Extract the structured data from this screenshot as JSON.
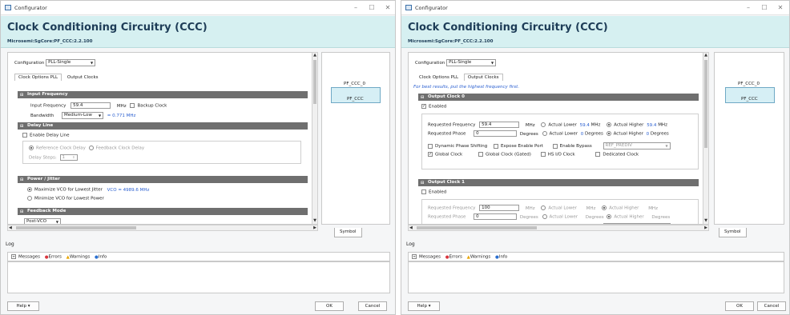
{
  "windows": [
    {
      "title": "Configurator",
      "header_title": "Clock Conditioning Circuitry (CCC)",
      "header_sub": "Microsemi:SgCore:PF_CCC:2.2.100",
      "config_label": "Configuration",
      "config_value": "PLL-Single",
      "tabs": [
        "Clock Options PLL",
        "Output Clocks"
      ],
      "sections": {
        "input": "Input Frequency",
        "delay": "Delay Line",
        "power": "Power / Jitter",
        "feedback": "Feedback Mode"
      },
      "input_freq_label": "Input Frequency",
      "input_freq_value": "59.4",
      "mhz": "MHz",
      "backup_clock": "Backup Clock",
      "bandwidth_label": "Bandwidth",
      "bandwidth_value": "Medium-Low",
      "bandwidth_result": "= 0.771 MHz",
      "enable_delay": "Enable Delay Line",
      "ref_clock_delay": "Reference Clock Delay",
      "fb_clock_delay": "Feedback Clock Delay",
      "delay_steps_label": "Delay Steps:",
      "delay_steps_value": "1",
      "max_vco": "Maximize VCO for Lowest Jitter",
      "vco_value": "VCO = 4989.6 MHz",
      "min_vco": "Minimize VCO for Lowest Power",
      "feedback_value": "Post-VCO",
      "symbol_name": "PF_CCC_0",
      "symbol_sub": "PF_CCC",
      "symbol_tab": "Symbol",
      "log_label": "Log",
      "log_filters": [
        "Messages",
        "Errors",
        "Warnings",
        "Info"
      ],
      "help": "Help",
      "ok": "OK",
      "cancel": "Cancel"
    },
    {
      "title": "Configurator",
      "header_title": "Clock Conditioning Circuitry (CCC)",
      "header_sub": "Microsemi:SgCore:PF_CCC:2.2.100",
      "config_label": "Configuration",
      "config_value": "PLL-Single",
      "tabs": [
        "Clock Options PLL",
        "Output Clocks"
      ],
      "hint": "For best results, put the highest frequency first.",
      "oc0": "Output Clock 0",
      "oc1": "Output Clock 1",
      "enabled": "Enabled",
      "req_freq_label": "Requested Frequency",
      "req_freq_0": "59.4",
      "req_freq_1": "100",
      "mhz": "MHz",
      "actual_lower": "Actual Lower",
      "actual_higher": "Actual Higher",
      "al_val_0": "59.4",
      "ah_val_0": "59.4",
      "req_phase_label": "Requested Phase",
      "req_phase_val": "0",
      "degrees": "Degrees",
      "pl_val": "0",
      "ph_val": "0",
      "dyn_phase": "Dynamic Phase Shifting",
      "expose_en": "Expose Enable Port",
      "enable_bypass": "Enable Bypass",
      "ref_prediv": "REF_PREDIV",
      "global_clock": "Global Clock",
      "global_gated": "Global Clock (Gated)",
      "hs_io": "HS I/O Clock",
      "dedicated": "Dedicated Clock",
      "symbol_name": "PF_CCC_0",
      "symbol_sub": "PF_CCC",
      "symbol_tab": "Symbol",
      "log_label": "Log",
      "log_filters": [
        "Messages",
        "Errors",
        "Warnings",
        "Info"
      ],
      "help": "Help",
      "ok": "OK",
      "cancel": "Cancel"
    }
  ],
  "colors": {
    "header_bg": "#d6f0f1",
    "section_bg": "#6f6f6f",
    "link_blue": "#2a5fd0",
    "error_red": "#d9363e",
    "warning_orange": "#e8a400",
    "info_blue": "#2a6fd0"
  }
}
